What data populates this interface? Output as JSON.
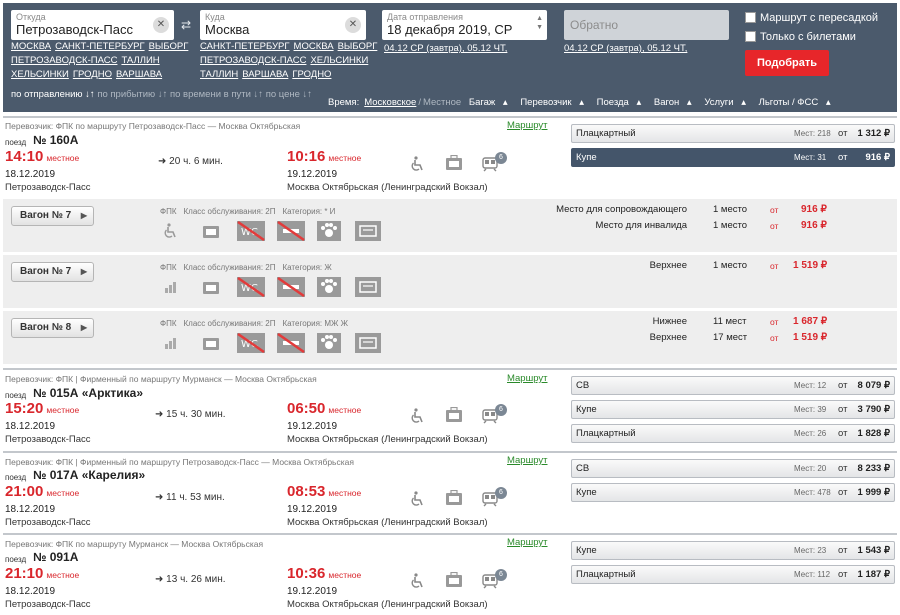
{
  "search": {
    "from_label": "Откуда",
    "from_value": "Петрозаводск-Пасс",
    "from_links": [
      "МОСКВА",
      "САНКТ-ПЕТЕРБУРГ",
      "ВЫБОРГ",
      "ПЕТРОЗАВОДСК-ПАСС",
      "ТАЛЛИН",
      "ХЕЛЬСИНКИ",
      "ГРОДНО",
      "ВАРШАВА"
    ],
    "to_label": "Куда",
    "to_value": "Москва",
    "to_links": [
      "САНКТ-ПЕТЕРБУРГ",
      "МОСКВА",
      "ВЫБОРГ",
      "ПЕТРОЗАВОДСК-ПАСС",
      "ХЕЛЬСИНКИ",
      "ТАЛЛИН",
      "ВАРШАВА",
      "ГРОДНО"
    ],
    "date_label": "Дата отправления",
    "date_value": "18 декабря 2019, СР",
    "date_quick": "04.12 СР (завтра), 05.12 ЧТ,",
    "back_placeholder": "Обратно",
    "back_quick": "04.12 СР (завтра), 05.12 ЧТ,",
    "transfer_label": "Маршрут с пересадкой",
    "tickets_only_label": "Только с билетами",
    "submit_label": "Подобрать"
  },
  "sort": {
    "by_departure": "по отправлению",
    "by_arrival": "по прибытию",
    "by_travel": "по времени в пути",
    "by_price": "по цене"
  },
  "filters": {
    "time_label": "Время:",
    "time_moscow": "Московское",
    "time_sep": "/",
    "time_local": "Местное",
    "baggage": "Багаж",
    "carrier": "Перевозчик",
    "train": "Поезда",
    "wagon": "Вагон",
    "services": "Услуги",
    "benefits": "Льготы / ФСС"
  },
  "route_link": "Маршрут",
  "train_word": "поезд",
  "local_word": "местное",
  "places_word": "Мест:",
  "from_word": "от",
  "trains": [
    {
      "carrier": "Перевозчик: ФПК   по маршруту Петрозаводск-Пасс — Москва Октябрьская",
      "number": "№ 160А",
      "dep_time": "14:10",
      "dep_date": "18.12.2019",
      "dep_station": "Петрозаводск-Пасс",
      "duration": "20 ч. 6 мин.",
      "arr_time": "10:16",
      "arr_date": "19.12.2019",
      "arr_station": "Москва Октябрьская (Ленинградский Вокзал)",
      "badge": "6",
      "classes": [
        {
          "name": "Плацкартный",
          "places": "218",
          "price": "1 312 ₽",
          "active": false
        },
        {
          "name": "Купе",
          "places": "31",
          "price": "916 ₽",
          "active": true
        }
      ]
    },
    {
      "carrier": "Перевозчик: ФПК | Фирменный   по маршруту Мурманск — Москва Октябрьская",
      "number": "№ 015А «Арктика»",
      "dep_time": "15:20",
      "dep_date": "18.12.2019",
      "dep_station": "Петрозаводск-Пасс",
      "duration": "15 ч. 30 мин.",
      "arr_time": "06:50",
      "arr_date": "19.12.2019",
      "arr_station": "Москва Октябрьская (Ленинградский Вокзал)",
      "badge": "6",
      "classes": [
        {
          "name": "СВ",
          "places": "12",
          "price": "8 079 ₽",
          "active": false
        },
        {
          "name": "Купе",
          "places": "39",
          "price": "3 790 ₽",
          "active": false
        },
        {
          "name": "Плацкартный",
          "places": "26",
          "price": "1 828 ₽",
          "active": false
        }
      ]
    },
    {
      "carrier": "Перевозчик: ФПК | Фирменный   по маршруту Петрозаводск-Пасс — Москва Октябрьская",
      "number": "№ 017А «Карелия»",
      "dep_time": "21:00",
      "dep_date": "18.12.2019",
      "dep_station": "Петрозаводск-Пасс",
      "duration": "11 ч. 53 мин.",
      "arr_time": "08:53",
      "arr_date": "19.12.2019",
      "arr_station": "Москва Октябрьская (Ленинградский Вокзал)",
      "badge": "6",
      "classes": [
        {
          "name": "СВ",
          "places": "20",
          "price": "8 233 ₽",
          "active": false
        },
        {
          "name": "Купе",
          "places": "478",
          "price": "1 999 ₽",
          "active": false
        }
      ]
    },
    {
      "carrier": "Перевозчик: ФПК   по маршруту Мурманск — Москва Октябрьская",
      "number": "№ 091А",
      "dep_time": "21:10",
      "dep_date": "18.12.2019",
      "dep_station": "Петрозаводск-Пасс",
      "duration": "13 ч. 26 мин.",
      "arr_time": "10:36",
      "arr_date": "19.12.2019",
      "arr_station": "Москва Октябрьская (Ленинградский Вокзал)",
      "badge": "6",
      "classes": [
        {
          "name": "Купе",
          "places": "23",
          "price": "1 543 ₽",
          "active": false
        },
        {
          "name": "Плацкартный",
          "places": "112",
          "price": "1 187 ₽",
          "active": false
        }
      ]
    }
  ],
  "wagons": [
    {
      "label": "Вагон № 7",
      "carrier": "ФПК",
      "service_class": "Класс обслуживания: 2П",
      "category": "Категория: * И",
      "seats": [
        {
          "type": "Место для сопровождающего",
          "count": "1 место",
          "price": "916 ₽"
        },
        {
          "type": "Место для инвалида",
          "count": "1 место",
          "price": "916 ₽"
        }
      ]
    },
    {
      "label": "Вагон № 7",
      "carrier": "ФПК",
      "service_class": "Класс обслуживания: 2П",
      "category": "Категория: Ж",
      "seats": [
        {
          "type": "Верхнее",
          "count": "1 место",
          "price": "1 519 ₽"
        }
      ]
    },
    {
      "label": "Вагон № 8",
      "carrier": "ФПК",
      "service_class": "Класс обслуживания: 2П",
      "category": "Категория: МЖ Ж",
      "seats": [
        {
          "type": "Нижнее",
          "count": "11 мест",
          "price": "1 687 ₽"
        },
        {
          "type": "Верхнее",
          "count": "17 мест",
          "price": "1 519 ₽"
        }
      ]
    }
  ],
  "colors": {
    "header": "#4b5a6c",
    "accent_red": "#d9262c",
    "button_red": "#e7262a",
    "link_green": "#2a8a2a",
    "active_class": "#44556a"
  }
}
